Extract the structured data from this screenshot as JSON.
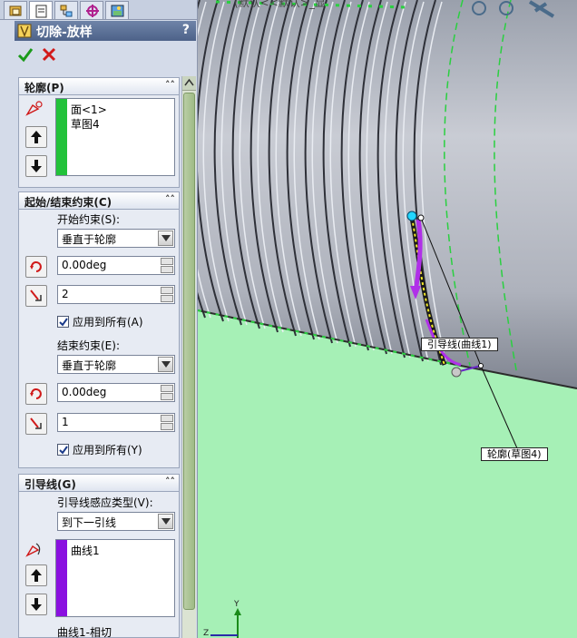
{
  "panel": {
    "title": "切除-放样",
    "help": "?",
    "sections": {
      "profile": {
        "header": "轮廓(P)",
        "items": [
          "面<1>",
          "草图4"
        ]
      },
      "constraints": {
        "header": "起始/结束约束(C)",
        "start_label": "开始约束(S):",
        "start_type": "垂直于轮廓",
        "start_angle": "0.00deg",
        "start_length": "2",
        "start_apply_all": "应用到所有(A)",
        "end_label": "结束约束(E):",
        "end_type": "垂直于轮廓",
        "end_angle": "0.00deg",
        "end_length": "1",
        "end_apply_all": "应用到所有(Y)"
      },
      "guides": {
        "header": "引导线(G)",
        "influence_label": "引导线感应类型(V):",
        "influence_type": "到下一引线",
        "items": [
          "曲线1"
        ],
        "footer": "曲线1-相切"
      }
    }
  },
  "viewport": {
    "breadcrumb": "(默认<<默认>_显",
    "callouts": {
      "guide": "引导线(曲线1)",
      "profile": "轮廓(草图4)"
    },
    "triad_y": "Y",
    "triad_z": "Z"
  },
  "colors": {
    "background": "#a6f0b6",
    "profile_bar": "#22c23a",
    "guide_bar": "#8a10e0",
    "guide_curve": "#b030e8",
    "cylinder": "#b9bdc8",
    "edge_dashes": "#2ad040"
  }
}
